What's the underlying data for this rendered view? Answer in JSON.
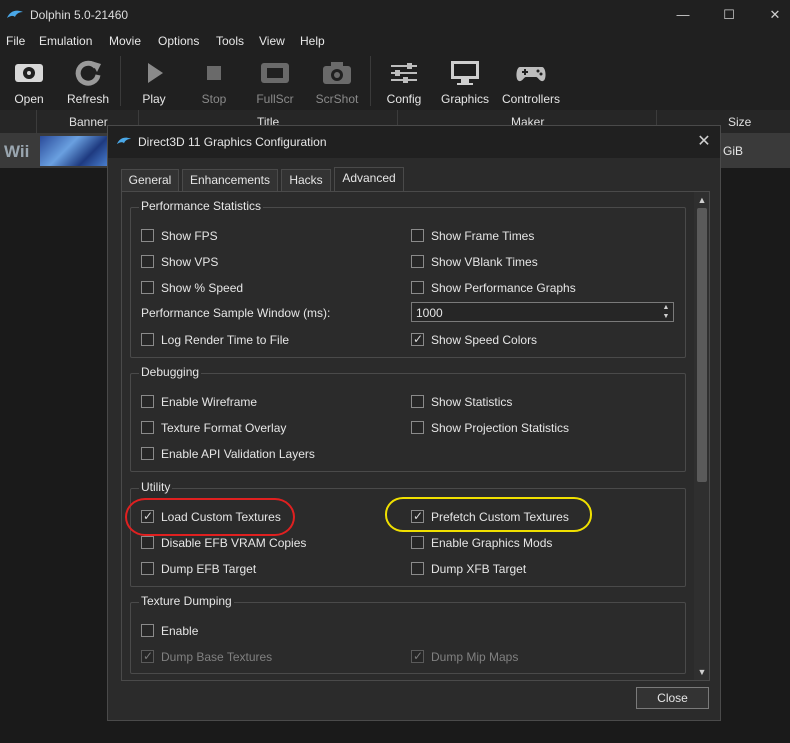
{
  "window": {
    "title": "Dolphin 5.0-21460",
    "minimize_glyph": "—",
    "maximize_glyph": "☐",
    "close_glyph": "✕"
  },
  "menu": [
    "File",
    "Emulation",
    "Movie",
    "Options",
    "Tools",
    "View",
    "Help"
  ],
  "toolbar": [
    {
      "label": "Open",
      "icon": "open-icon",
      "enabled": true
    },
    {
      "label": "Refresh",
      "icon": "refresh-icon",
      "enabled": true
    },
    {
      "label": "Play",
      "icon": "play-icon",
      "enabled": true
    },
    {
      "label": "Stop",
      "icon": "stop-icon",
      "enabled": false
    },
    {
      "label": "FullScr",
      "icon": "fullscreen-icon",
      "enabled": false
    },
    {
      "label": "ScrShot",
      "icon": "camera-icon",
      "enabled": false
    },
    {
      "label": "Config",
      "icon": "sliders-icon",
      "enabled": true
    },
    {
      "label": "Graphics",
      "icon": "monitor-icon",
      "enabled": true
    },
    {
      "label": "Controllers",
      "icon": "gamepad-icon",
      "enabled": true
    }
  ],
  "game_list": {
    "columns": [
      "Banner",
      "Title",
      "Maker",
      "Size"
    ],
    "row": {
      "platform": "Wii",
      "size": "GiB"
    }
  },
  "dialog": {
    "title": "Direct3D 11 Graphics Configuration",
    "close_glyph": "✕",
    "tabs": [
      {
        "label": "General",
        "active": false
      },
      {
        "label": "Enhancements",
        "active": false
      },
      {
        "label": "Hacks",
        "active": false
      },
      {
        "label": "Advanced",
        "active": true
      }
    ],
    "groups": {
      "performance": {
        "title": "Performance Statistics",
        "show_fps": {
          "label": "Show FPS",
          "checked": false
        },
        "show_frame_times": {
          "label": "Show Frame Times",
          "checked": false
        },
        "show_vps": {
          "label": "Show VPS",
          "checked": false
        },
        "show_vblank_times": {
          "label": "Show VBlank Times",
          "checked": false
        },
        "show_speed": {
          "label": "Show % Speed",
          "checked": false
        },
        "show_perf_graphs": {
          "label": "Show Performance Graphs",
          "checked": false
        },
        "sample_window_label": "Performance Sample Window (ms):",
        "sample_window_value": "1000",
        "log_render_time": {
          "label": "Log Render Time to File",
          "checked": false
        },
        "show_speed_colors": {
          "label": "Show Speed Colors",
          "checked": true
        }
      },
      "debugging": {
        "title": "Debugging",
        "enable_wireframe": {
          "label": "Enable Wireframe",
          "checked": false
        },
        "show_statistics": {
          "label": "Show Statistics",
          "checked": false
        },
        "texture_format_overlay": {
          "label": "Texture Format Overlay",
          "checked": false
        },
        "show_projection_statistics": {
          "label": "Show Projection Statistics",
          "checked": false
        },
        "enable_api_validation": {
          "label": "Enable API Validation Layers",
          "checked": false
        }
      },
      "utility": {
        "title": "Utility",
        "load_custom_textures": {
          "label": "Load Custom Textures",
          "checked": true
        },
        "prefetch_custom_textures": {
          "label": "Prefetch Custom Textures",
          "checked": true
        },
        "disable_efb_vram": {
          "label": "Disable EFB VRAM Copies",
          "checked": false
        },
        "enable_graphics_mods": {
          "label": "Enable Graphics Mods",
          "checked": false
        },
        "dump_efb_target": {
          "label": "Dump EFB Target",
          "checked": false
        },
        "dump_xfb_target": {
          "label": "Dump XFB Target",
          "checked": false
        }
      },
      "texture_dumping": {
        "title": "Texture Dumping",
        "enable": {
          "label": "Enable",
          "checked": false
        },
        "dump_base_textures": {
          "label": "Dump Base Textures",
          "checked": true,
          "enabled": false
        },
        "dump_mip_maps": {
          "label": "Dump Mip Maps",
          "checked": true,
          "enabled": false
        }
      }
    },
    "close_button": "Close"
  },
  "annotations": {
    "red_ellipse_color": "#e02020",
    "yellow_ellipse_color": "#f0e000"
  }
}
